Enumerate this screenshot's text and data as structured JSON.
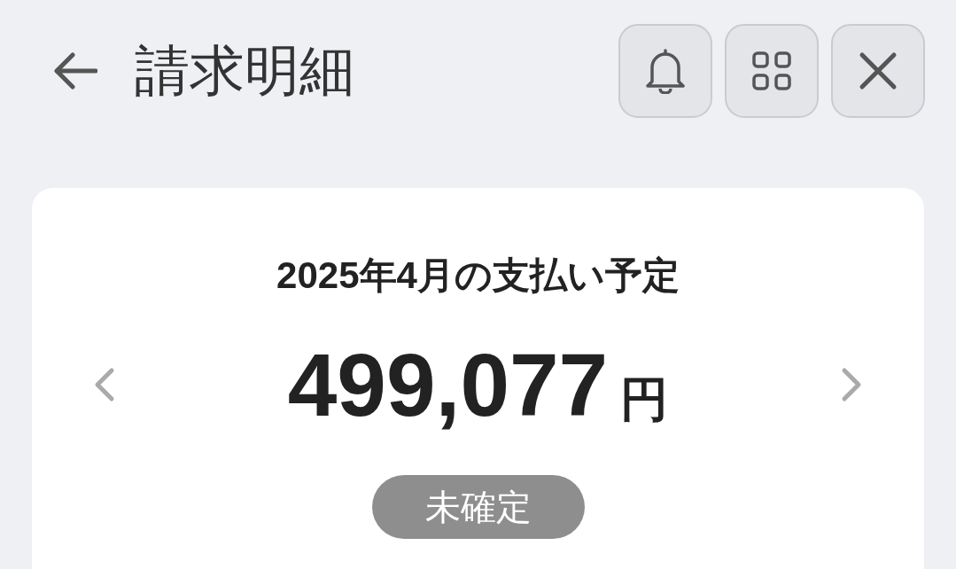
{
  "header": {
    "title": "請求明細"
  },
  "statement": {
    "title": "2025年4月の支払い予定",
    "amount": "499,077",
    "currency": "円",
    "status": "未確定"
  }
}
